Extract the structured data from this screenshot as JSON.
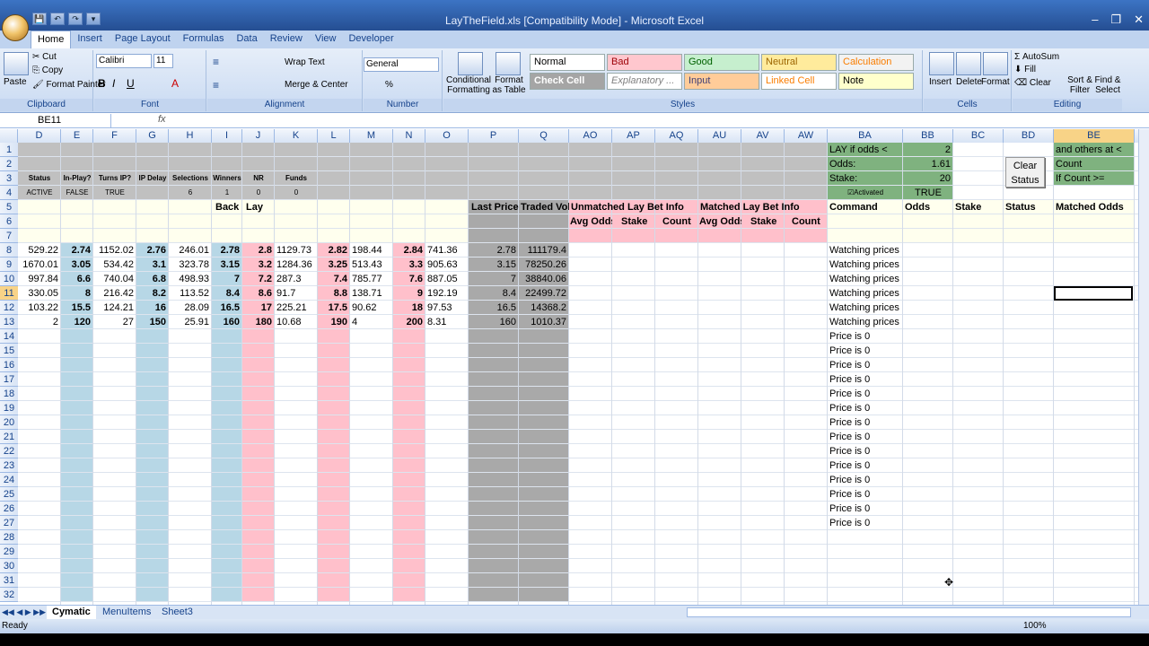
{
  "window": {
    "title": "LayTheField.xls [Compatibility Mode] - Microsoft Excel",
    "controls": [
      "–",
      "❐",
      "✕"
    ]
  },
  "qat": [
    "💾",
    "↶",
    "↷",
    "▾"
  ],
  "tabs": [
    "Home",
    "Insert",
    "Page Layout",
    "Formulas",
    "Data",
    "Review",
    "View",
    "Developer"
  ],
  "ribbon": {
    "clipboard": {
      "label": "Clipboard",
      "paste": "Paste",
      "cut": "Cut",
      "copy": "Copy",
      "format_painter": "Format Painter"
    },
    "font": {
      "label": "Font",
      "name": "Calibri",
      "size": "11"
    },
    "alignment": {
      "label": "Alignment",
      "wrap": "Wrap Text",
      "merge": "Merge & Center"
    },
    "number": {
      "label": "Number",
      "format": "General"
    },
    "styles": {
      "label": "Styles",
      "conditional": "Conditional Formatting",
      "format_table": "Format as Table",
      "cells": [
        {
          "t": "Normal",
          "bg": "#ffffff",
          "fg": "#000000"
        },
        {
          "t": "Bad",
          "bg": "#ffc7ce",
          "fg": "#9c0006"
        },
        {
          "t": "Good",
          "bg": "#c6efce",
          "fg": "#006100"
        },
        {
          "t": "Neutral",
          "bg": "#ffeb9c",
          "fg": "#9c6500"
        },
        {
          "t": "Calculation",
          "bg": "#f2f2f2",
          "fg": "#fa7d00"
        },
        {
          "t": "Check Cell",
          "bg": "#a5a5a5",
          "fg": "#ffffff"
        },
        {
          "t": "Explanatory ...",
          "bg": "#ffffff",
          "fg": "#7f7f7f"
        },
        {
          "t": "Input",
          "bg": "#ffcc99",
          "fg": "#3f3f76"
        },
        {
          "t": "Linked Cell",
          "bg": "#ffffff",
          "fg": "#fa7d00"
        },
        {
          "t": "Note",
          "bg": "#ffffcc",
          "fg": "#000000"
        }
      ]
    },
    "cells": {
      "label": "Cells",
      "insert": "Insert",
      "delete": "Delete",
      "format": "Format"
    },
    "editing": {
      "label": "Editing",
      "autosum": "AutoSum",
      "fill": "Fill",
      "clear": "Clear",
      "sort": "Sort & Filter",
      "find": "Find & Select"
    }
  },
  "formula_bar": {
    "name_box": "BE11",
    "fx": "fx",
    "value": ""
  },
  "columns": [
    "D",
    "E",
    "F",
    "G",
    "H",
    "I",
    "J",
    "K",
    "L",
    "M",
    "N",
    "O",
    "P",
    "Q",
    "AO",
    "AP",
    "AQ",
    "AU",
    "AV",
    "AW",
    "BA",
    "BB",
    "BC",
    "BD",
    "BE"
  ],
  "rows": [
    "1",
    "2",
    "3",
    "4",
    "5",
    "6",
    "7",
    "8",
    "9",
    "10",
    "11",
    "12",
    "13",
    "14",
    "15",
    "16",
    "17",
    "18",
    "19",
    "20",
    "21",
    "22",
    "23",
    "24",
    "25",
    "26",
    "27",
    "28",
    "29",
    "30",
    "31",
    "32"
  ],
  "header_labels": {
    "status": "Status",
    "inplay": "In-Play?",
    "turns": "Turns IP?",
    "ipdelay": "IP Delay",
    "selections": "Selections",
    "winners": "Winners",
    "nr": "NR",
    "funds": "Funds",
    "active": "ACTIVE",
    "false": "FALSE",
    "true": "TRUE",
    "sel_val": "6",
    "win_val": "1",
    "nr_val": "0",
    "funds_val": "0",
    "back": "Back",
    "lay": "Lay",
    "last_price": "Last Price",
    "traded_vol": "Traded Vol",
    "unmatched": "Unmatched Lay Bet Info",
    "matched": "Matched Lay Bet Info",
    "avg_odds": "Avg Odds",
    "stake": "Stake",
    "count": "Count",
    "command": "Command",
    "odds": "Odds",
    "stake2": "Stake",
    "status2": "Status",
    "matched_odds": "Matched Odds"
  },
  "settings": {
    "lay_if": "LAY if odds <",
    "lay_val": "2",
    "odds": "Odds:",
    "odds_val": "1.61",
    "stake": "Stake:",
    "stake_val": "20",
    "activated": "Activated",
    "act_val": "TRUE",
    "others1": "and others at <",
    "others2": "Count",
    "others3": "If Count >="
  },
  "clear_button": [
    "Clear",
    "Status"
  ],
  "data_rows": [
    {
      "D": "529.22",
      "E": "2.74",
      "F": "1152.02",
      "G": "2.76",
      "H": "246.01",
      "I": "2.78",
      "J": "2.8",
      "K": "1129.73",
      "L": "2.82",
      "M": "198.44",
      "N": "2.84",
      "O": "741.36",
      "P": "2.78",
      "Q": "111179.4",
      "BA": "Watching prices"
    },
    {
      "D": "1670.01",
      "E": "3.05",
      "F": "534.42",
      "G": "3.1",
      "H": "323.78",
      "I": "3.15",
      "J": "3.2",
      "K": "1284.36",
      "L": "3.25",
      "M": "513.43",
      "N": "3.3",
      "O": "905.63",
      "P": "3.15",
      "Q": "78250.26",
      "BA": "Watching prices"
    },
    {
      "D": "997.84",
      "E": "6.6",
      "F": "740.04",
      "G": "6.8",
      "H": "498.93",
      "I": "7",
      "J": "7.2",
      "K": "287.3",
      "L": "7.4",
      "M": "785.77",
      "N": "7.6",
      "O": "887.05",
      "P": "7",
      "Q": "38840.06",
      "BA": "Watching prices"
    },
    {
      "D": "330.05",
      "E": "8",
      "F": "216.42",
      "G": "8.2",
      "H": "113.52",
      "I": "8.4",
      "J": "8.6",
      "K": "91.7",
      "L": "8.8",
      "M": "138.71",
      "N": "9",
      "O": "192.19",
      "P": "8.4",
      "Q": "22499.72",
      "BA": "Watching prices"
    },
    {
      "D": "103.22",
      "E": "15.5",
      "F": "124.21",
      "G": "16",
      "H": "28.09",
      "I": "16.5",
      "J": "17",
      "K": "225.21",
      "L": "17.5",
      "M": "90.62",
      "N": "18",
      "O": "97.53",
      "P": "16.5",
      "Q": "14368.2",
      "BA": "Watching prices"
    },
    {
      "D": "2",
      "E": "120",
      "F": "27",
      "G": "150",
      "H": "25.91",
      "I": "160",
      "J": "180",
      "K": "10.68",
      "L": "190",
      "M": "4",
      "N": "200",
      "O": "8.31",
      "P": "160",
      "Q": "1010.37",
      "BA": "Watching prices"
    }
  ],
  "price_zero": "Price is 0",
  "sheets": [
    "Cymatic",
    "MenuItems",
    "Sheet3"
  ],
  "status": {
    "ready": "Ready",
    "zoom": "100%"
  }
}
